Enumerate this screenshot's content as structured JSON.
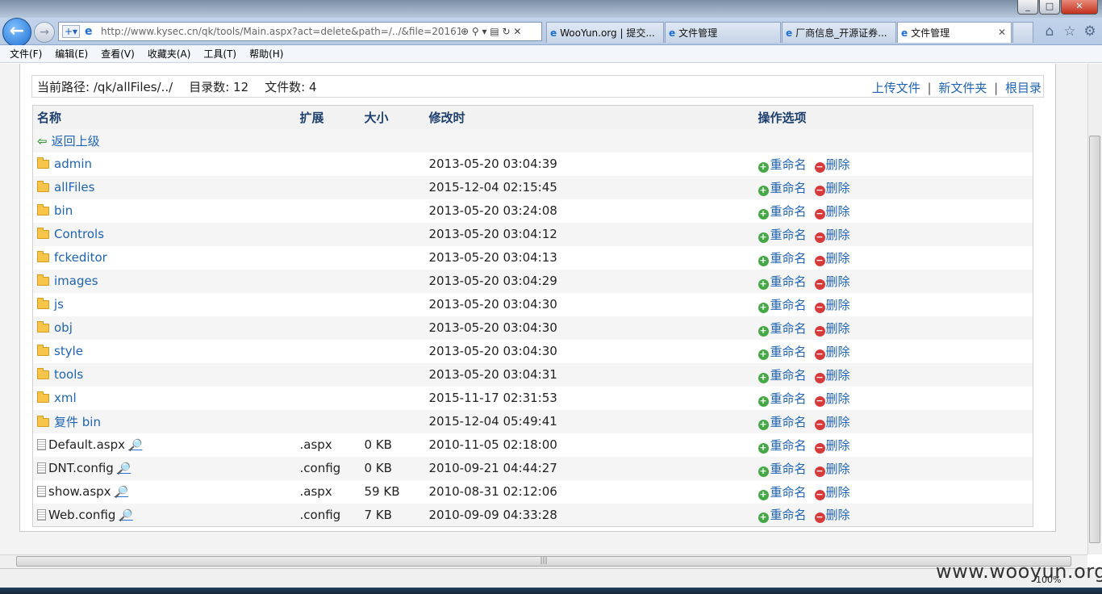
{
  "browser": {
    "url": "http://www.kysec.cn/qk/tools/Main.aspx?act=delete&path=/../&file=20161",
    "tabs": [
      {
        "label": "WooYun.org | 提交..."
      },
      {
        "label": "文件管理"
      },
      {
        "label": "厂商信息_开源证券..."
      },
      {
        "label": "文件管理"
      }
    ],
    "menu": [
      "文件(F)",
      "编辑(E)",
      "查看(V)",
      "收藏夹(A)",
      "工具(T)",
      "帮助(H)"
    ],
    "zoom": "100%"
  },
  "pathbar": {
    "current_path_label": "当前路径: /qk/allFiles/../",
    "dir_count_label": "目录数: 12",
    "file_count_label": "文件数: 4",
    "upload": "上传文件",
    "new_folder": "新文件夹",
    "root_dir": "根目录",
    "sep": "|"
  },
  "table": {
    "headers": {
      "name": "名称",
      "ext": "扩展",
      "size": "大小",
      "mtime": "修改时",
      "ops": "操作选项"
    },
    "back_label": "返回上级",
    "rename": "重命名",
    "delete": "删除",
    "folders": [
      {
        "name": "admin",
        "mtime": "2013-05-20 03:04:39"
      },
      {
        "name": "allFiles",
        "mtime": "2015-12-04 02:15:45"
      },
      {
        "name": "bin",
        "mtime": "2013-05-20 03:24:08"
      },
      {
        "name": "Controls",
        "mtime": "2013-05-20 03:04:12"
      },
      {
        "name": "fckeditor",
        "mtime": "2013-05-20 03:04:13"
      },
      {
        "name": "images",
        "mtime": "2013-05-20 03:04:29"
      },
      {
        "name": "js",
        "mtime": "2013-05-20 03:04:30"
      },
      {
        "name": "obj",
        "mtime": "2013-05-20 03:04:30"
      },
      {
        "name": "style",
        "mtime": "2013-05-20 03:04:30"
      },
      {
        "name": "tools",
        "mtime": "2013-05-20 03:04:31"
      },
      {
        "name": "xml",
        "mtime": "2015-11-17 02:31:53"
      },
      {
        "name": "复件 bin",
        "mtime": "2015-12-04 05:49:41"
      }
    ],
    "files": [
      {
        "name": "Default.aspx",
        "ext": ".aspx",
        "size": "0 KB",
        "mtime": "2010-11-05 02:18:00"
      },
      {
        "name": "DNT.config",
        "ext": ".config",
        "size": "0 KB",
        "mtime": "2010-09-21 04:44:27"
      },
      {
        "name": "show.aspx",
        "ext": ".aspx",
        "size": "59 KB",
        "mtime": "2010-08-31 02:12:06"
      },
      {
        "name": "Web.config",
        "ext": ".config",
        "size": "7 KB",
        "mtime": "2010-09-09 04:33:28"
      }
    ]
  },
  "watermark": "www.wooyun.org"
}
